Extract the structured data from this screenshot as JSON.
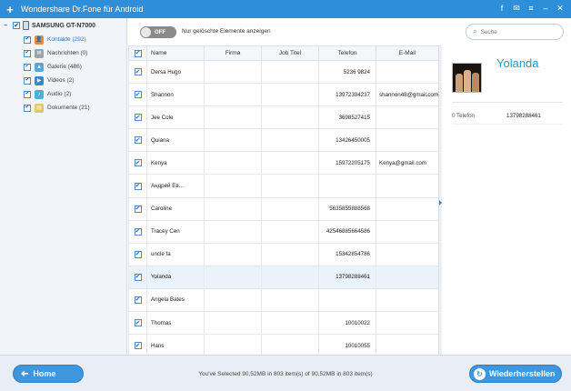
{
  "app": {
    "title": "Wondershare Dr.Fone für Android",
    "logo_icon": "plus-logo-icon",
    "window_controls": [
      {
        "name": "facebook-icon",
        "glyph": "f"
      },
      {
        "name": "feedback-icon",
        "glyph": "✉"
      },
      {
        "name": "menu-icon",
        "glyph": "≡"
      },
      {
        "name": "minimize-icon",
        "glyph": "–"
      },
      {
        "name": "close-icon",
        "glyph": "✕"
      }
    ]
  },
  "sidebar": {
    "collapse_glyph": "−",
    "device_name": "SAMSUNG GT-N7000",
    "categories": [
      {
        "label": "Kontakte (292)",
        "icon": "contacts-icon",
        "color": "#e98a2e",
        "glyph": "👤",
        "active": true
      },
      {
        "label": "Nachrichten (0)",
        "icon": "messages-icon",
        "color": "#9aa3ab",
        "glyph": "✉",
        "active": false
      },
      {
        "label": "Galerie (486)",
        "icon": "gallery-icon",
        "color": "#57a8d6",
        "glyph": "▲",
        "active": false
      },
      {
        "label": "Videos (2)",
        "icon": "videos-icon",
        "color": "#3f86c9",
        "glyph": "▶",
        "active": false
      },
      {
        "label": "Audio (2)",
        "icon": "audio-icon",
        "color": "#4cb0d8",
        "glyph": "♪",
        "active": false
      },
      {
        "label": "Dokumente (21)",
        "icon": "documents-icon",
        "color": "#e3c56a",
        "glyph": "▤",
        "active": false
      }
    ]
  },
  "toolbar": {
    "toggle_label": "OFF",
    "toggle_hint": "Nur gelöschte Elemente anzeigen",
    "search_placeholder": "Suche",
    "search_icon_glyph": "⌕"
  },
  "table": {
    "check_glyph": "✔",
    "columns": [
      "",
      "Name",
      "Firma",
      "Job Titel",
      "Telefon",
      "E-Mail"
    ],
    "rows": [
      {
        "name": "Dersa Hugo",
        "firma": "",
        "job": "",
        "tel": "5236 9824",
        "mail": ""
      },
      {
        "name": "Shannon",
        "firma": "",
        "job": "",
        "tel": "13972394237",
        "mail": "shannon48@gmail.com"
      },
      {
        "name": "Jee Cole",
        "firma": "",
        "job": "",
        "tel": "3698527415",
        "mail": ""
      },
      {
        "name": "Quiana",
        "firma": "",
        "job": "",
        "tel": "13426450005",
        "mail": ""
      },
      {
        "name": "Kenya",
        "firma": "",
        "job": "",
        "tel": "15972205175",
        "mail": "Kenya@gmail.com"
      },
      {
        "name": "Андрей Ев...",
        "firma": "",
        "job": "",
        "tel": "",
        "mail": ""
      },
      {
        "name": "Caroline",
        "firma": "",
        "job": "",
        "tel": "5635855888568",
        "mail": ""
      },
      {
        "name": "Tracey Cen",
        "firma": "",
        "job": "",
        "tel": "42546885664586",
        "mail": ""
      },
      {
        "name": "uncle fa",
        "firma": "",
        "job": "",
        "tel": "15342854786",
        "mail": ""
      },
      {
        "name": "Yolanda",
        "firma": "",
        "job": "",
        "tel": "13798288461",
        "mail": "",
        "selected": true
      },
      {
        "name": "Angela Bates",
        "firma": "",
        "job": "",
        "tel": "",
        "mail": ""
      },
      {
        "name": "Thomas",
        "firma": "",
        "job": "",
        "tel": "10010022",
        "mail": ""
      },
      {
        "name": "Hans",
        "firma": "",
        "job": "",
        "tel": "10010055",
        "mail": ""
      }
    ]
  },
  "detail": {
    "name": "Yolanda",
    "field_label": "0 Telefon",
    "field_value": "13798288461"
  },
  "footer": {
    "home_label": "Home",
    "home_glyph": "➜",
    "status": "You've Selected 90,52MB in 803 item(s) of 90,52MB in 803 item(s)",
    "restore_label": "Wiederherstellen",
    "restore_glyph": "↻"
  },
  "colors": {
    "accent": "#2e8fd8",
    "name_highlight": "#1a9ccb"
  }
}
